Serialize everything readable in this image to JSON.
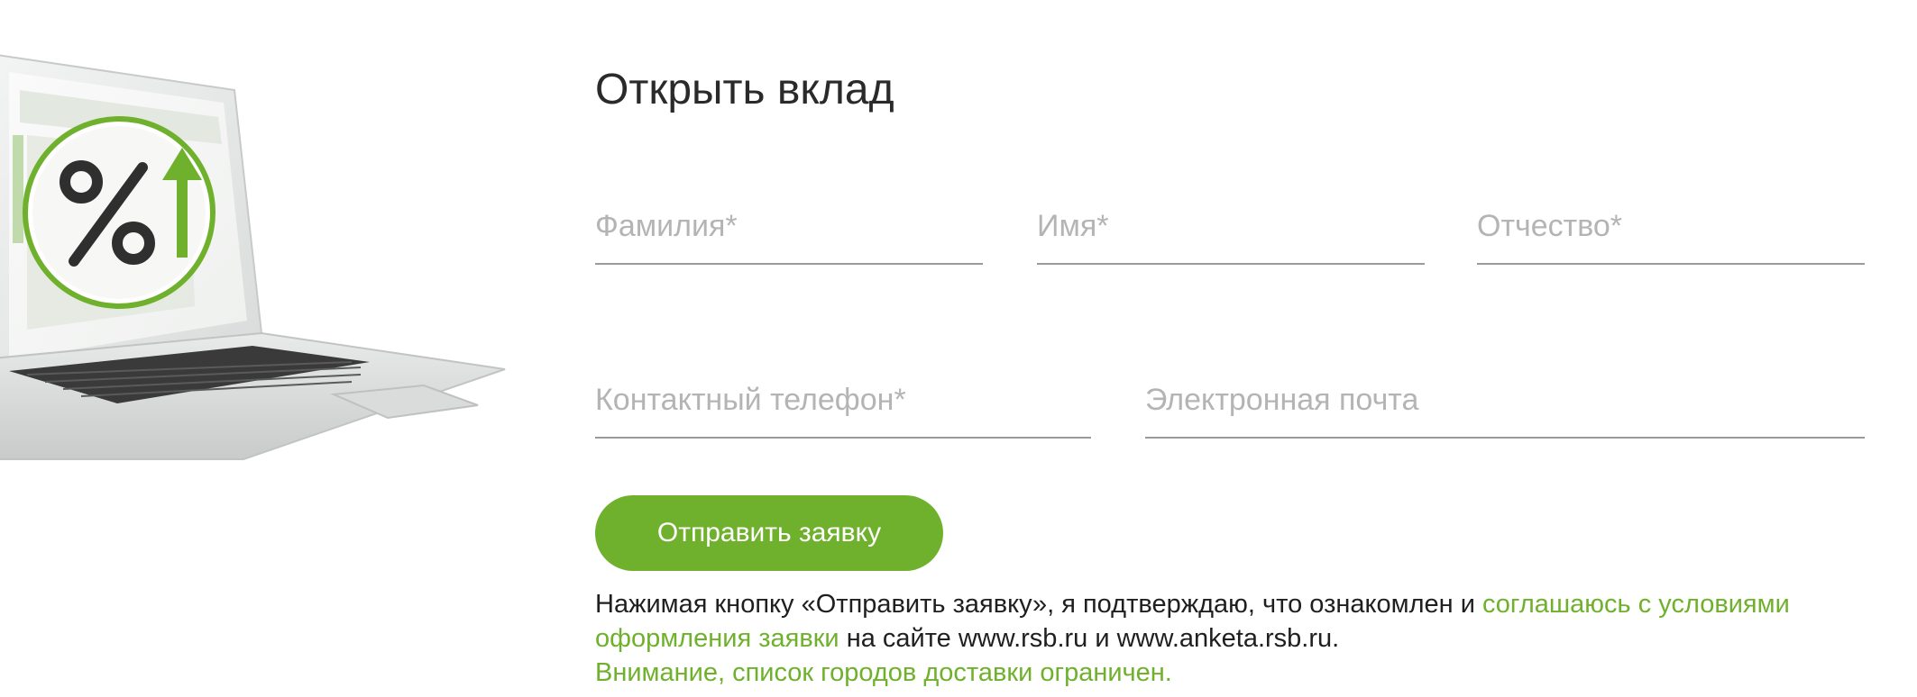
{
  "form": {
    "title": "Открыть вклад",
    "fields": {
      "lastname": {
        "placeholder": "Фамилия*",
        "value": ""
      },
      "firstname": {
        "placeholder": "Имя*",
        "value": ""
      },
      "middlename": {
        "placeholder": "Отчество*",
        "value": ""
      },
      "phone": {
        "placeholder": "Контактный телефон*",
        "value": ""
      },
      "email": {
        "placeholder": "Электронная почта",
        "value": ""
      }
    },
    "submit_label": "Отправить заявку",
    "consent": {
      "text_before": "Нажимая кнопку «Отправить заявку», я подтверждаю, что ознакомлен и ",
      "link_text": "соглашаюсь с условиями оформления заявки",
      "text_after": " на сайте www.rsb.ru и www.anketa.rsb.ru."
    },
    "notice": "Внимание, список городов доставки ограничен."
  },
  "illustration": {
    "icon": "laptop-with-percent-up-icon",
    "percent_glyph": "%"
  },
  "colors": {
    "accent": "#6fb12c",
    "field_underline": "#9a9a9a",
    "placeholder": "#b4b4b4",
    "title": "#2a2a2a"
  }
}
